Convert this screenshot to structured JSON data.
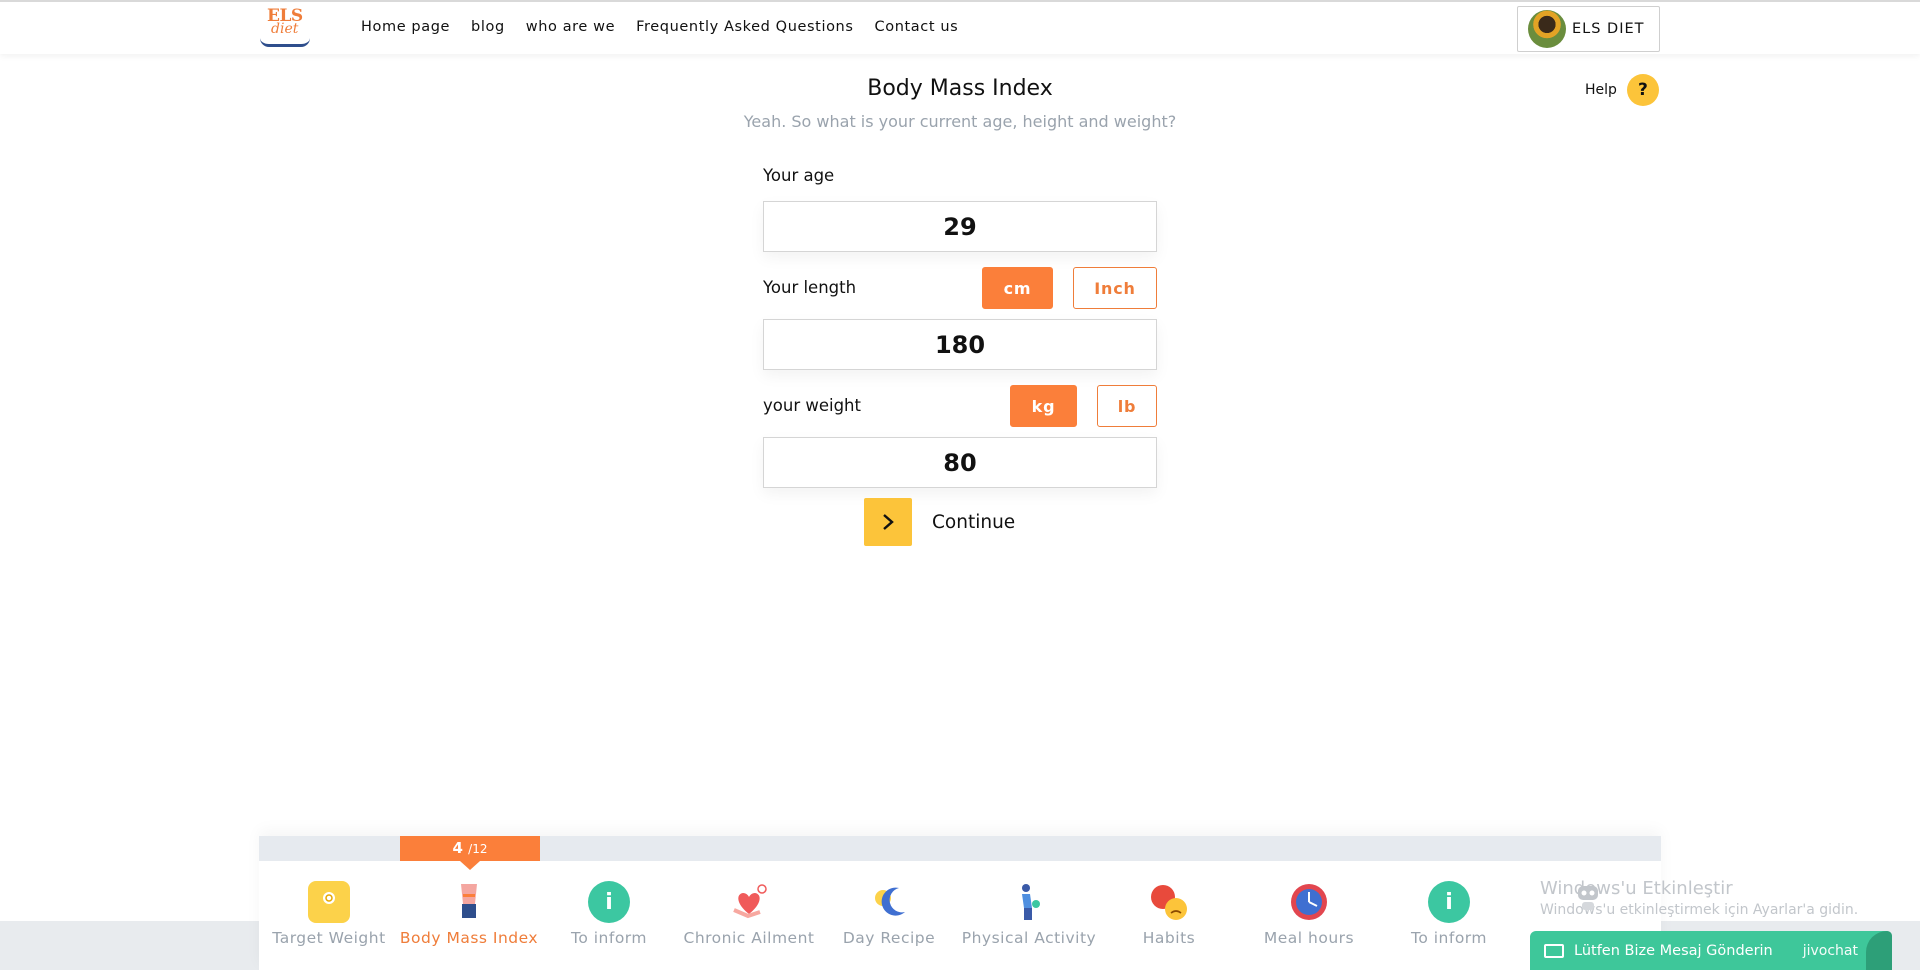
{
  "header": {
    "logo_top": "ELS",
    "logo_bottom": "diet",
    "nav": [
      "Home page",
      "blog",
      "who are we",
      "Frequently Asked Questions",
      "Contact us"
    ],
    "profile_name": "ELS DIET"
  },
  "page": {
    "title": "Body Mass Index",
    "subtitle": "Yeah. So what is your current age, height and weight?",
    "help_label": "Help",
    "help_icon": "?"
  },
  "form": {
    "age_label": "Your age",
    "age_value": "29",
    "length_label": "Your length",
    "length_units": [
      "cm",
      "Inch"
    ],
    "length_value": "180",
    "weight_label": "your weight",
    "weight_units": [
      "kg",
      "lb"
    ],
    "weight_value": "80",
    "continue_label": "Continue"
  },
  "progress": {
    "current": "4",
    "total": "/12"
  },
  "steps": [
    {
      "label": "Target Weight",
      "icon": "scale-icon",
      "color": "#fcd24a"
    },
    {
      "label": "Body Mass Index",
      "icon": "body-icon",
      "color": "#f4a6a0"
    },
    {
      "label": "To inform",
      "icon": "info-icon",
      "color": "#3cc7a1"
    },
    {
      "label": "Chronic Ailment",
      "icon": "heart-hand-icon",
      "color": "#f05a5a"
    },
    {
      "label": "Day Recipe",
      "icon": "sun-moon-icon",
      "color": "#3f6fd1"
    },
    {
      "label": "Physical Activity",
      "icon": "fitness-icon",
      "color": "#3a5aa8"
    },
    {
      "label": "Habits",
      "icon": "emoji-icon",
      "color": "#e84a3c"
    },
    {
      "label": "Meal hours",
      "icon": "clock-icon",
      "color": "#e2464f"
    },
    {
      "label": "To inform",
      "icon": "info-icon",
      "color": "#3cc7a1"
    }
  ],
  "windows_notice": {
    "title": "Windows'u Etkinleştir",
    "subtitle": "Windows'u etkinleştirmek için Ayarlar'a gidin."
  },
  "chat": {
    "text": "Lütfen Bize Mesaj Gönderin",
    "brand": "jivochat"
  },
  "colors": {
    "accent_orange": "#fb7f3a",
    "accent_yellow": "#fcc43a",
    "chat_green": "#3ec79a"
  }
}
